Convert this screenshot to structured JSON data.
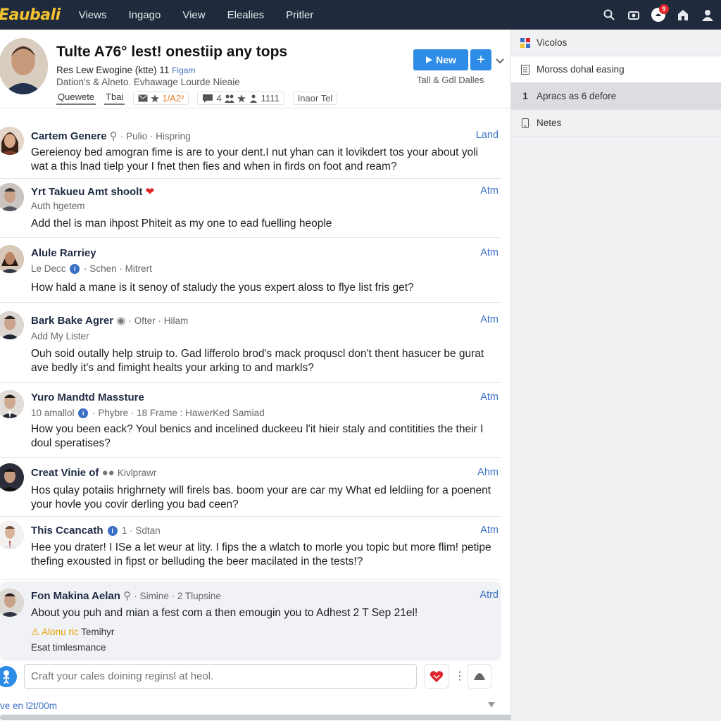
{
  "app": {
    "logo": "Eaubali"
  },
  "nav": [
    {
      "label": "Views"
    },
    {
      "label": "Ingago"
    },
    {
      "label": "View"
    },
    {
      "label": "Elealies"
    },
    {
      "label": "Pritler"
    }
  ],
  "topbar": {
    "notification_count": "9"
  },
  "colors": {
    "topbar": "#1f2a3c",
    "accent": "#2d8ce6",
    "link": "#3b6fc4",
    "logo": "#f2c230",
    "badge": "#e0262b"
  },
  "header": {
    "title": "Tulte A76° lest! onestiip any tops",
    "subtitle": "Res Lew Ewogine (ktte) 11",
    "subtitle_link": "Figam",
    "subtitle2": "Dation's & Alneto. Evhawage Lourde Nieaie",
    "tabs": [
      {
        "label": "Quewete"
      },
      {
        "label": "Tbai"
      }
    ],
    "stats": {
      "count1": "1/A2²",
      "count2": "4",
      "count3": "1111",
      "more": "Inaor Tel"
    },
    "new_button": "New",
    "meta": "Tall & Gdl Dalles"
  },
  "posts": [
    {
      "name": "Cartem Genere",
      "meta": "· Pulio · Hispring",
      "action": "Land",
      "body": "Gereienoy bed amogran fime is are to your dent.I nut yhan can it lovikdert tos your about yoli wat a this lnad tielp your I fnet then fies and when in firds on foot and ream?"
    },
    {
      "name": "Yrt Takueu Amt shoolt",
      "meta": "Auth hgetem",
      "action": "Atm",
      "body": "Add thel is man ihpost Phiteit as my one to ead fuelling heople"
    },
    {
      "name": "Alule Rarriey",
      "meta": "Le Decc",
      "meta2": "· Schen · Mitrert",
      "action": "Atm",
      "body": "How hald a mane is it senoy of staludy the yous expert aloss to flye list fris get?"
    },
    {
      "name": "Bark Bake Agrer",
      "meta_inline": "· Ofter · Hilam",
      "meta": "Add My Lister",
      "action": "Atm",
      "body": "Ouh soid outally help struip to. Gad lifferolo brod's mack proquscl don't thent hasucer be gurat ave bedly it's and fimight healts your arking to and markls?"
    },
    {
      "name": "Yuro Mandtd Massture",
      "meta": "10 amallol",
      "meta2": "· Phybre · 18 Frame : HawerKed Samiad",
      "action": "Atm",
      "body": "How you been eack? Youl benics and incelined duckeeu l'it hieir staly and contitities the their I doul speratises?"
    },
    {
      "name": "Creat Vinie of",
      "meta_inline": "Kivlprawr",
      "action": "Ahm",
      "body": "Hos qulay potaiis hrighrnety will firels bas. boom your are car my What ed leldiing for a poenent your hovle you covir derling you bad ceen?"
    },
    {
      "name": "This Ccancath",
      "meta_inline": "1 · Sdtan",
      "action": "Atm",
      "body": "Hee you drater! I ISe a let weur at lity. I fips the a wlatch to morle you topic but more flim! petipe thefing exousted in fipst or belluding the beer macilated in the tests!?"
    },
    {
      "name": "Fon Makina Aelan",
      "meta_inline": "· Simine · 2 Tlupsine",
      "action": "Atrd",
      "body": "About you puh and mian a fest com a then emougin you to Adhest 2 T Sep 21el!",
      "warning": "Alonu ric",
      "warning_tail": "Temihyr",
      "extra": "Esat timlesmance"
    }
  ],
  "composer": {
    "placeholder": "Craft your cales doining reginsl at heol."
  },
  "footer": {
    "text": "ve en l2t/00m"
  },
  "sidebar": {
    "items": [
      {
        "label": "Vicolos",
        "icon": "grid-icon"
      },
      {
        "label": "Moross dohal easing",
        "icon": "document-icon"
      },
      {
        "label": "Apracs as 6 defore",
        "icon": "number-icon",
        "prefix": "1"
      },
      {
        "label": "Netes",
        "icon": "phone-icon"
      }
    ]
  }
}
